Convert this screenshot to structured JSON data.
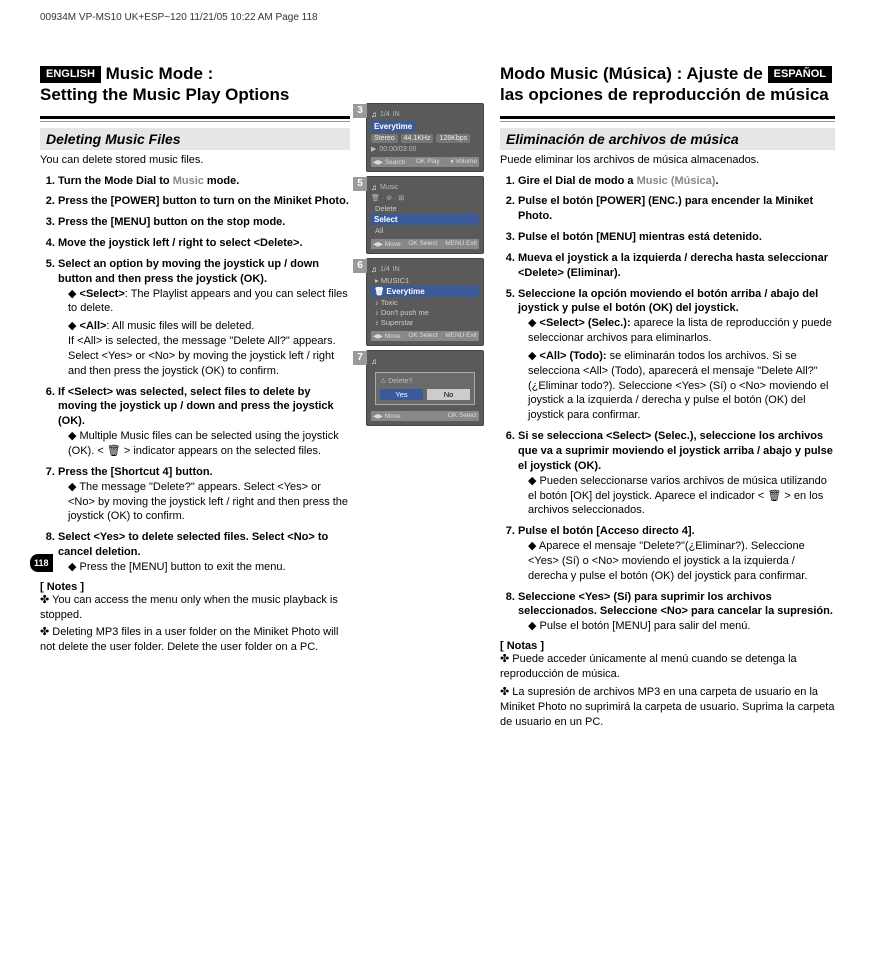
{
  "meta": {
    "header": "00934M VP-MS10 UK+ESP~120  11/21/05 10:22 AM  Page 118"
  },
  "pagenum": "118",
  "en": {
    "lang": "ENGLISH",
    "title1": "Music Mode :",
    "title2": "Setting the Music Play Options",
    "subhead": "Deleting Music Files",
    "intro": "You can delete stored music files.",
    "s1": "Turn the Mode Dial to ",
    "s1b": "Music",
    "s1c": " mode.",
    "s2": "Press the [POWER] button to turn on the Miniket Photo.",
    "s3": "Press the [MENU] button on the stop mode.",
    "s4": "Move the joystick left / right to select <Delete>.",
    "s5": "Select an option by moving the joystick up / down button and then press the joystick (OK).",
    "s5a": "<Select>: The Playlist appears and you can select files to delete.",
    "s5b_a": "<All>: All music files will be deleted.",
    "s5b_b": "If <All> is selected, the message \"Delete All?\" appears. Select <Yes> or <No> by moving the joystick left / right and then press the joystick (OK) to confirm.",
    "s6": "If <Select> was selected, select files to delete by moving the joystick up / down and press the joystick (OK).",
    "s6a": "Multiple Music files can be selected using the joystick (OK). <  🗑  > indicator appears on the selected files.",
    "s7": "Press the [Shortcut 4] button.",
    "s7a": "The message \"Delete?\" appears. Select <Yes> or <No> by moving the joystick left / right and then press the joystick (OK) to confirm.",
    "s8": "Select <Yes> to delete selected files. Select <No> to cancel deletion.",
    "s8a": "Press the [MENU] button to exit the menu.",
    "notes_head": "[ Notes ]",
    "n1": "You can access the menu only when the music playback is stopped.",
    "n2": "Deleting MP3 files in a user folder on the Miniket Photo will not delete the user folder. Delete the user folder on a PC."
  },
  "es": {
    "lang": "ESPAÑOL",
    "title1": "Modo Music (Música) : Ajuste de",
    "title2": "las opciones de reproducción de música",
    "subhead": "Eliminación de archivos de música",
    "intro": "Puede eliminar los archivos de música almacenados.",
    "s1a": "Gire el Dial de modo a ",
    "s1b": "Music (Música)",
    "s1c": ".",
    "s2": "Pulse el botón [POWER] (ENC.) para encender la Miniket Photo.",
    "s3": "Pulse el botón [MENU] mientras está detenido.",
    "s4": "Mueva el joystick a la izquierda / derecha hasta seleccionar <Delete> (Eliminar).",
    "s5": "Seleccione la opción moviendo el botón arriba / abajo del joystick y pulse el botón (OK) del joystick.",
    "s5a": "<Select> (Selec.): aparece la lista de reproducción y puede seleccionar archivos para eliminarlos.",
    "s5b": "<All> (Todo): se eliminarán todos los archivos. Si se selecciona <All> (Todo), aparecerá el mensaje \"Delete All?\" (¿Eliminar todo?). Seleccione <Yes> (Sí) o <No> moviendo el joystick a la izquierda / derecha y pulse el botón (OK) del joystick para confirmar.",
    "s6": "Si se selecciona <Select> (Selec.), seleccione los archivos que va a suprimir moviendo el joystick arriba / abajo y pulse el joystick (OK).",
    "s6a": "Pueden seleccionarse varios archivos de música utilizando el botón [OK] del joystick. Aparece el indicador <  🗑  > en los archivos seleccionados.",
    "s7": "Pulse el botón [Acceso directo 4].",
    "s7a": "Aparece el mensaje \"Delete?\"(¿Eliminar?). Seleccione <Yes> (Sí) o <No> moviendo el joystick a la izquierda / derecha y pulse el botón (OK) del joystick para confirmar.",
    "s8": "Seleccione <Yes> (Sí) para suprimir los archivos seleccionados. Seleccione <No> para cancelar la supresión.",
    "s8a": "Pulse el botón [MENU] para salir del menú.",
    "notes_head": "[ Notas ]",
    "n1": "Puede acceder únicamente al menú cuando se detenga la reproducción de música.",
    "n2": "La supresión de archivos MP3 en una carpeta de usuario en la Miniket Photo no suprimirá la carpeta de usuario. Suprima la carpeta de usuario en un PC."
  },
  "figs": {
    "f3": {
      "num": "3",
      "track": "Everytime",
      "stereo": "Stereo",
      "khz": "44.1KHz",
      "kbps": "128Kbps",
      "time": "00:00/03:00",
      "foot1": "Search",
      "foot2": "Play",
      "foot3": "Volume",
      "count": "1/4",
      "in": "IN"
    },
    "f5": {
      "num": "5",
      "title": "Music",
      "menu": "Delete",
      "opt1": "Select",
      "opt2": "All",
      "foot1": "Move",
      "foot2": "Select",
      "foot3": "Exit"
    },
    "f6": {
      "num": "6",
      "count": "1/4",
      "in": "IN",
      "folder": "MUSIC1",
      "t1": "Everytime",
      "t2": "Toxic",
      "t3": "Don't push me",
      "t4": "Superstar",
      "foot1": "Move",
      "foot2": "Select",
      "foot3": "Exit"
    },
    "f7": {
      "num": "7",
      "prompt": "Delete?",
      "yes": "Yes",
      "no": "No",
      "foot1": "Move",
      "foot2": "Select"
    }
  }
}
